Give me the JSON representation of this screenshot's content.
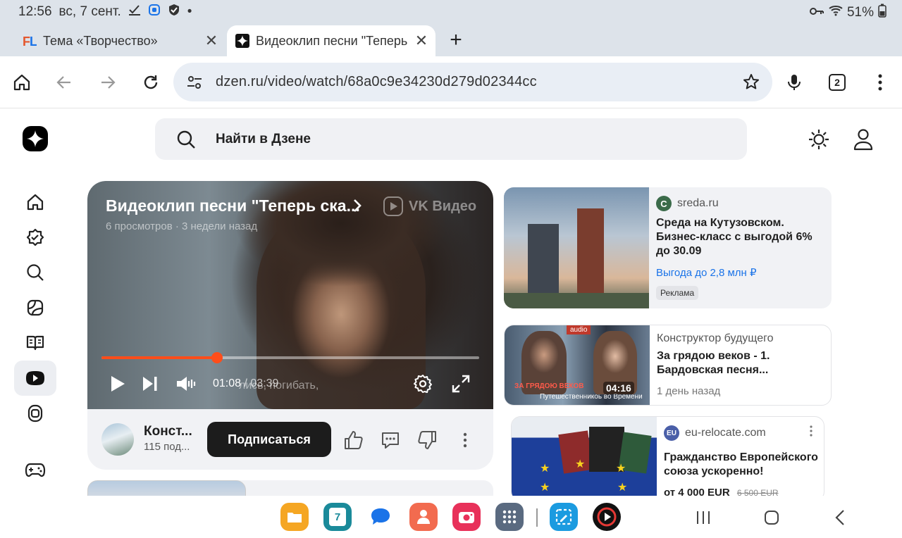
{
  "status_bar": {
    "time": "12:56",
    "date": "вс, 7 сент.",
    "dot": "•",
    "battery": "51%",
    "icons": [
      "check-icon",
      "app-icon",
      "shield-icon",
      "key-icon",
      "wifi-icon",
      "battery-icon"
    ]
  },
  "tabs": [
    {
      "label": "Тема «Творчество»",
      "favicon": "FL",
      "active": false
    },
    {
      "label": "Видеоклип песни \"Теперь с",
      "favicon": "zen-star",
      "active": true
    }
  ],
  "new_tab": "+",
  "toolbar": {
    "url": "dzen.ru/video/watch/68a0c9e34230d279d02344cc",
    "tab_count": "2"
  },
  "header": {
    "search_placeholder": "Найти в Дзене"
  },
  "sidebar": {
    "items": [
      "home",
      "subscriptions",
      "search",
      "shorts",
      "articles",
      "video",
      "live",
      "games"
    ],
    "active": "video"
  },
  "video": {
    "title": "Видеоклип песни \"Теперь ска...",
    "meta": "6 просмотров · 3 недели назад",
    "provider": "VK Видео",
    "current_time": "01:08",
    "duration": "/ 03:39",
    "subtitle": "лись, погибать,",
    "progress": 0.306
  },
  "channel": {
    "name": "Конст...",
    "subs": "115 под...",
    "subscribe_label": "Подписаться"
  },
  "recommendations": [
    {
      "source": "sreda.ru",
      "headline": "Среда на Кутузовском. Бизнес-класс с выгодой 6% до 30.09",
      "cta": "Выгода до 2,8 млн ₽",
      "badge": "Реклама"
    },
    {
      "source": "Конструктор будущего",
      "headline": "За грядою веков - 1. Бардовская песня...",
      "date": "1 день назад",
      "duration": "04:16",
      "thumb_tag": "audio",
      "thumb_caption": "ЗА ГРЯДОЮ ВЕКОВ",
      "thumb_sub": "Путешественникоь во Времени"
    },
    {
      "source": "eu-relocate.com",
      "headline": "Гражданство Европейского союза ускоренно!",
      "price": "от 4 000 EUR",
      "old_price": "6 500 EUR"
    }
  ],
  "colors": {
    "accent": "#ff4d1a",
    "link": "#1a73e8",
    "dark": "#1c1c1c"
  },
  "dock": [
    "files-icon",
    "calendar-icon",
    "messages-icon",
    "contacts-icon",
    "camera-icon",
    "apps-grid-icon",
    "screenshot-icon",
    "video-player-icon"
  ],
  "calendar_day": "7"
}
